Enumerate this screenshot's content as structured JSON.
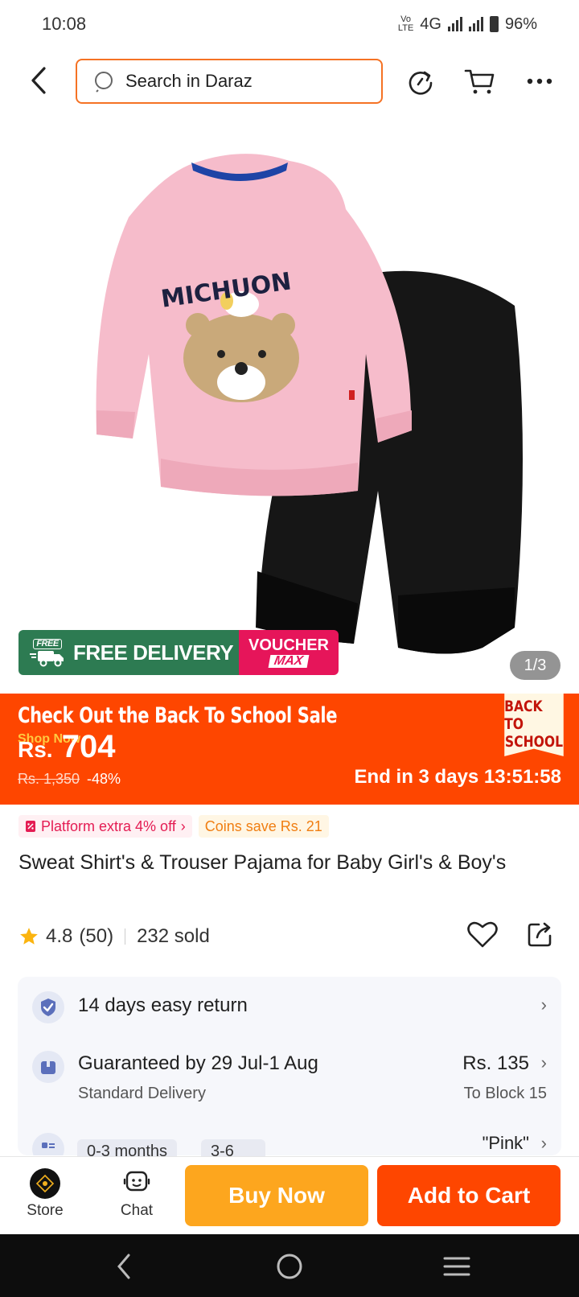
{
  "status_bar": {
    "time": "10:08",
    "network_label": "4G",
    "battery": "96%"
  },
  "search": {
    "placeholder": "Search in Daraz"
  },
  "product_image": {
    "print_text": "MICHUON",
    "promo_free_tag": "FREE",
    "promo_free_delivery": "FREE DELIVERY",
    "promo_voucher": "VOUCHER",
    "promo_voucher_max": "MAX",
    "counter": "1/3"
  },
  "sale": {
    "title": "Check Out the Back To School Sale",
    "shop_now": "Shop Now",
    "currency": "Rs.",
    "price": "704",
    "original_price": "Rs. 1,350",
    "discount": "-48%",
    "timer": "End in 3 days 13:51:58",
    "badge_line1": "BACK TO",
    "badge_line2": "SCHOOL"
  },
  "tags": {
    "platform": "Platform extra 4% off",
    "coins": "Coins save Rs. 21"
  },
  "product": {
    "title": "Sweat Shirt's & Trouser Pajama for Baby Girl's & Boy's",
    "rating": "4.8",
    "reviews": "(50)",
    "sold": "232 sold"
  },
  "services": {
    "returns": "14 days easy return",
    "delivery": "Guaranteed by 29 Jul-1 Aug",
    "delivery_type": "Standard Delivery",
    "delivery_fee": "Rs. 135",
    "delivery_location": "To Block 15",
    "variant_1": "0-3 months",
    "variant_2": "3-6",
    "variant_selected": "\"Pink\""
  },
  "bottom_bar": {
    "store": "Store",
    "chat": "Chat",
    "buy_now": "Buy Now",
    "add_to_cart": "Add to Cart"
  },
  "colors": {
    "accent": "#fe4600",
    "buy": "#fda61e",
    "search_border": "#f57224",
    "free_green": "#2d7b52",
    "voucher_pink": "#e6155a"
  }
}
